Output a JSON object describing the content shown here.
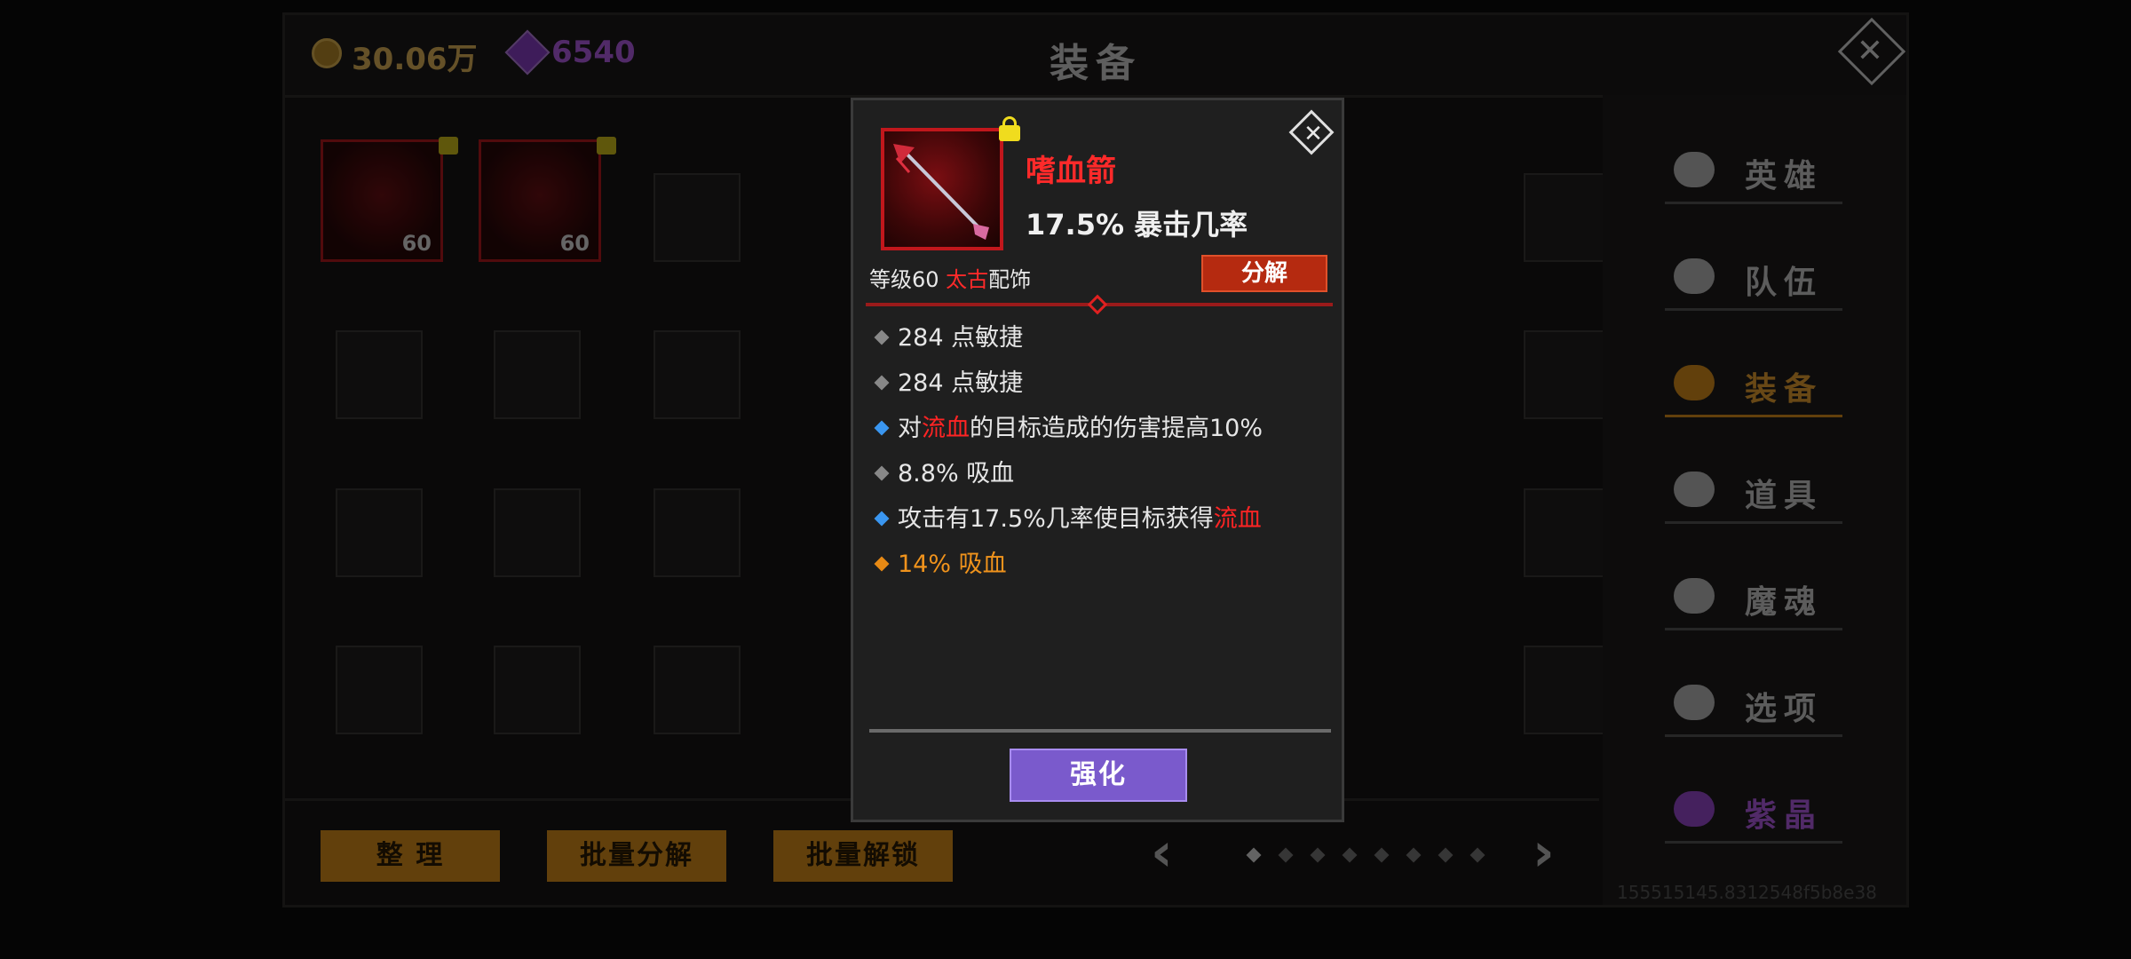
{
  "currency": {
    "gold": "30.06万",
    "gems": "6540"
  },
  "screen_title": "装备",
  "bottom_buttons": {
    "sort": "整 理",
    "batch_disassemble": "批量分解",
    "batch_unlock": "批量解锁"
  },
  "inventory": {
    "item1_level": "60",
    "item2_level": "60"
  },
  "sidebar": {
    "items": [
      {
        "label": "英雄"
      },
      {
        "label": "队伍"
      },
      {
        "label": "装备"
      },
      {
        "label": "道具"
      },
      {
        "label": "魔魂"
      },
      {
        "label": "选项"
      },
      {
        "label": "紫晶"
      }
    ]
  },
  "version_text": "155515145.8312548f5b8e38",
  "popup": {
    "item_name": "嗜血箭",
    "main_stat": "17.5% 暴击几率",
    "level_prefix": "等级60 ",
    "tier": "太古",
    "category": "配饰",
    "disassemble_label": "分解",
    "upgrade_label": "强化",
    "attributes": {
      "a1": "284 点敏捷",
      "a2": "284 点敏捷",
      "a3_pre": "对",
      "a3_red": "流血",
      "a3_post": "的目标造成的伤害提高10%",
      "a4": "8.8% 吸血",
      "a5_pre": "攻击有17.5%几率使目标获得",
      "a5_red": "流血",
      "a6": "14% 吸血"
    }
  },
  "colors": {
    "item_name": "#ff2a2a",
    "legendary_tier": "#ff2a2a",
    "upgrade_button": "#7a5acc",
    "disassemble_button": "#b52a10",
    "orange_affix": "#f0931c",
    "blue_affix": "#3a96f0"
  }
}
